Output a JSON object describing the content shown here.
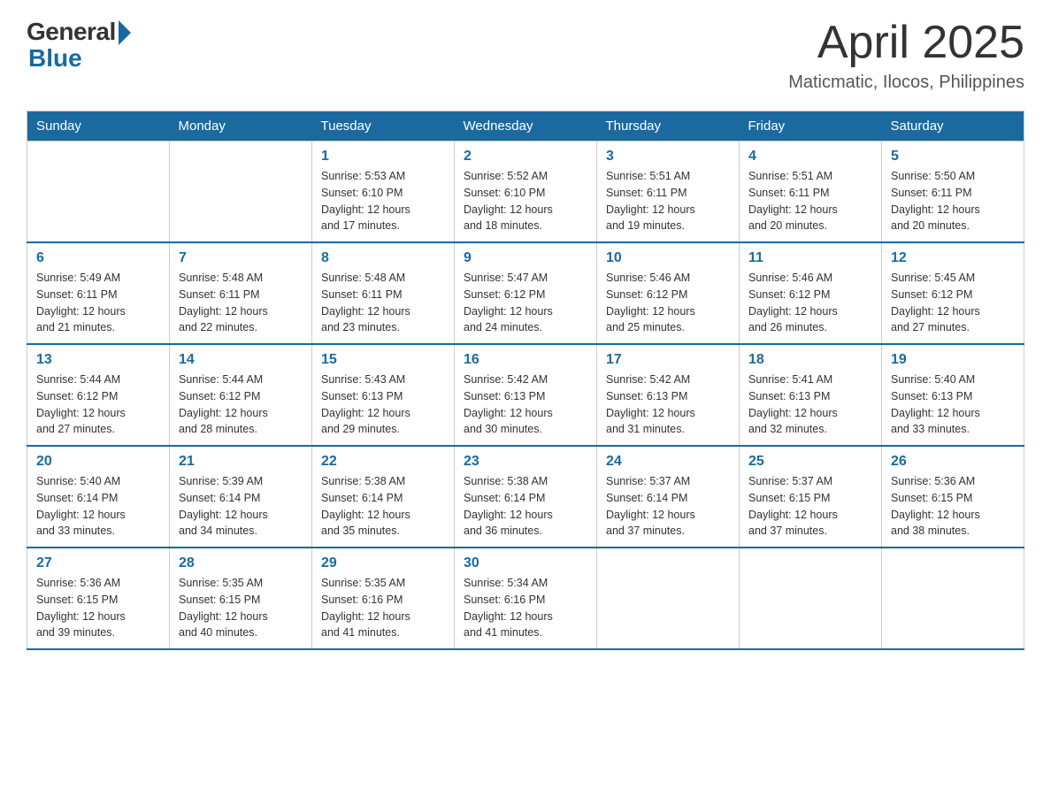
{
  "logo": {
    "general": "General",
    "blue": "Blue"
  },
  "title": {
    "month": "April 2025",
    "location": "Maticmatic, Ilocos, Philippines"
  },
  "weekdays": [
    "Sunday",
    "Monday",
    "Tuesday",
    "Wednesday",
    "Thursday",
    "Friday",
    "Saturday"
  ],
  "weeks": [
    [
      {
        "day": "",
        "info": ""
      },
      {
        "day": "",
        "info": ""
      },
      {
        "day": "1",
        "info": "Sunrise: 5:53 AM\nSunset: 6:10 PM\nDaylight: 12 hours\nand 17 minutes."
      },
      {
        "day": "2",
        "info": "Sunrise: 5:52 AM\nSunset: 6:10 PM\nDaylight: 12 hours\nand 18 minutes."
      },
      {
        "day": "3",
        "info": "Sunrise: 5:51 AM\nSunset: 6:11 PM\nDaylight: 12 hours\nand 19 minutes."
      },
      {
        "day": "4",
        "info": "Sunrise: 5:51 AM\nSunset: 6:11 PM\nDaylight: 12 hours\nand 20 minutes."
      },
      {
        "day": "5",
        "info": "Sunrise: 5:50 AM\nSunset: 6:11 PM\nDaylight: 12 hours\nand 20 minutes."
      }
    ],
    [
      {
        "day": "6",
        "info": "Sunrise: 5:49 AM\nSunset: 6:11 PM\nDaylight: 12 hours\nand 21 minutes."
      },
      {
        "day": "7",
        "info": "Sunrise: 5:48 AM\nSunset: 6:11 PM\nDaylight: 12 hours\nand 22 minutes."
      },
      {
        "day": "8",
        "info": "Sunrise: 5:48 AM\nSunset: 6:11 PM\nDaylight: 12 hours\nand 23 minutes."
      },
      {
        "day": "9",
        "info": "Sunrise: 5:47 AM\nSunset: 6:12 PM\nDaylight: 12 hours\nand 24 minutes."
      },
      {
        "day": "10",
        "info": "Sunrise: 5:46 AM\nSunset: 6:12 PM\nDaylight: 12 hours\nand 25 minutes."
      },
      {
        "day": "11",
        "info": "Sunrise: 5:46 AM\nSunset: 6:12 PM\nDaylight: 12 hours\nand 26 minutes."
      },
      {
        "day": "12",
        "info": "Sunrise: 5:45 AM\nSunset: 6:12 PM\nDaylight: 12 hours\nand 27 minutes."
      }
    ],
    [
      {
        "day": "13",
        "info": "Sunrise: 5:44 AM\nSunset: 6:12 PM\nDaylight: 12 hours\nand 27 minutes."
      },
      {
        "day": "14",
        "info": "Sunrise: 5:44 AM\nSunset: 6:12 PM\nDaylight: 12 hours\nand 28 minutes."
      },
      {
        "day": "15",
        "info": "Sunrise: 5:43 AM\nSunset: 6:13 PM\nDaylight: 12 hours\nand 29 minutes."
      },
      {
        "day": "16",
        "info": "Sunrise: 5:42 AM\nSunset: 6:13 PM\nDaylight: 12 hours\nand 30 minutes."
      },
      {
        "day": "17",
        "info": "Sunrise: 5:42 AM\nSunset: 6:13 PM\nDaylight: 12 hours\nand 31 minutes."
      },
      {
        "day": "18",
        "info": "Sunrise: 5:41 AM\nSunset: 6:13 PM\nDaylight: 12 hours\nand 32 minutes."
      },
      {
        "day": "19",
        "info": "Sunrise: 5:40 AM\nSunset: 6:13 PM\nDaylight: 12 hours\nand 33 minutes."
      }
    ],
    [
      {
        "day": "20",
        "info": "Sunrise: 5:40 AM\nSunset: 6:14 PM\nDaylight: 12 hours\nand 33 minutes."
      },
      {
        "day": "21",
        "info": "Sunrise: 5:39 AM\nSunset: 6:14 PM\nDaylight: 12 hours\nand 34 minutes."
      },
      {
        "day": "22",
        "info": "Sunrise: 5:38 AM\nSunset: 6:14 PM\nDaylight: 12 hours\nand 35 minutes."
      },
      {
        "day": "23",
        "info": "Sunrise: 5:38 AM\nSunset: 6:14 PM\nDaylight: 12 hours\nand 36 minutes."
      },
      {
        "day": "24",
        "info": "Sunrise: 5:37 AM\nSunset: 6:14 PM\nDaylight: 12 hours\nand 37 minutes."
      },
      {
        "day": "25",
        "info": "Sunrise: 5:37 AM\nSunset: 6:15 PM\nDaylight: 12 hours\nand 37 minutes."
      },
      {
        "day": "26",
        "info": "Sunrise: 5:36 AM\nSunset: 6:15 PM\nDaylight: 12 hours\nand 38 minutes."
      }
    ],
    [
      {
        "day": "27",
        "info": "Sunrise: 5:36 AM\nSunset: 6:15 PM\nDaylight: 12 hours\nand 39 minutes."
      },
      {
        "day": "28",
        "info": "Sunrise: 5:35 AM\nSunset: 6:15 PM\nDaylight: 12 hours\nand 40 minutes."
      },
      {
        "day": "29",
        "info": "Sunrise: 5:35 AM\nSunset: 6:16 PM\nDaylight: 12 hours\nand 41 minutes."
      },
      {
        "day": "30",
        "info": "Sunrise: 5:34 AM\nSunset: 6:16 PM\nDaylight: 12 hours\nand 41 minutes."
      },
      {
        "day": "",
        "info": ""
      },
      {
        "day": "",
        "info": ""
      },
      {
        "day": "",
        "info": ""
      }
    ]
  ]
}
